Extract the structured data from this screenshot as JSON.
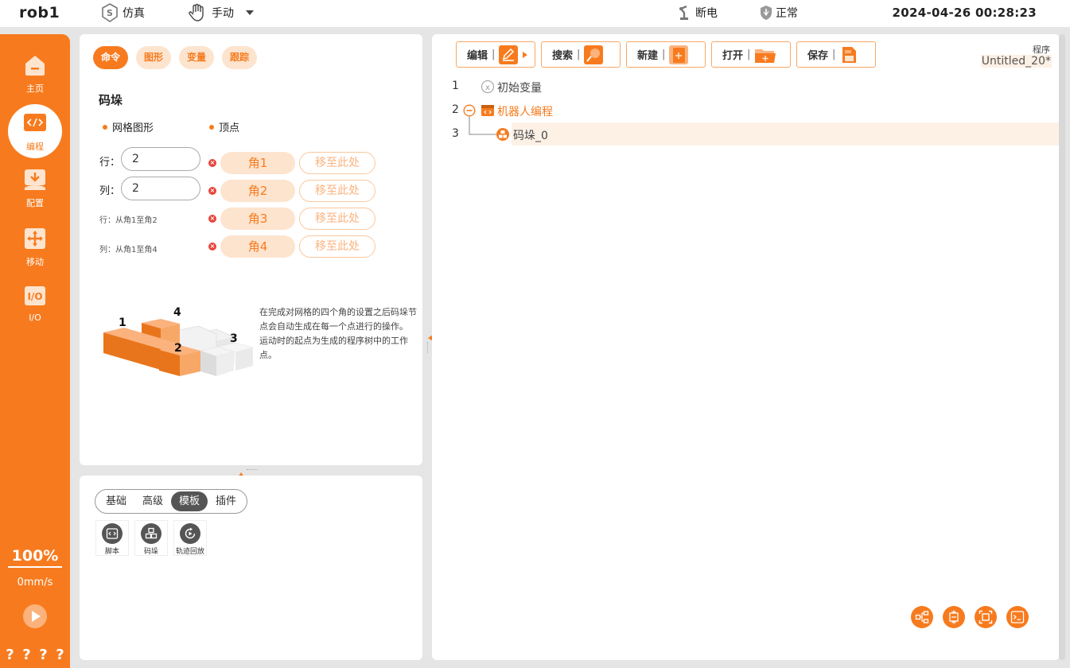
{
  "topbar": {
    "robot_name": "rob1",
    "sim_label": "仿真",
    "mode_label": "手动",
    "power_label": "断电",
    "status_label": "正常",
    "datetime": "2024-04-26 00:28:23"
  },
  "nav": {
    "items": [
      {
        "label": "主页",
        "icon": "home-icon"
      },
      {
        "label": "编程",
        "icon": "code-icon",
        "active": true
      },
      {
        "label": "配置",
        "icon": "config-download-icon"
      },
      {
        "label": "移动",
        "icon": "move-arrows-icon"
      },
      {
        "label": "I/O",
        "icon": "io-icon"
      }
    ],
    "speed_percent": "100%",
    "speed_value": "0mm/s",
    "help": [
      "?",
      "?",
      "?",
      "?"
    ]
  },
  "command_panel": {
    "tabs": [
      "命令",
      "图形",
      "变量",
      "跟踪"
    ],
    "active_tab": "命令",
    "section_title": "码垛",
    "mode_options": [
      "网格图形",
      "顶点"
    ],
    "row_label": "行：",
    "row_value": "2",
    "col_label": "列：",
    "col_value": "2",
    "row_hint": "行：从角1至角2",
    "col_hint": "列：从角1至角4",
    "corners": [
      "角1",
      "角2",
      "角3",
      "角4"
    ],
    "move_here": "移至此处",
    "illustration_labels": [
      "1",
      "2",
      "3",
      "4"
    ],
    "description_1": "在完成对网格的四个角的设置之后码垛节点会自动生成在每一个点进行的操作。",
    "description_2": "运动时的起点为生成的程序树中的工作点。"
  },
  "library_panel": {
    "tabs": [
      "基础",
      "高级",
      "模板",
      "插件"
    ],
    "active_tab": "模板",
    "items": [
      {
        "label": "脚本",
        "icon": "script-icon"
      },
      {
        "label": "码垛",
        "icon": "palletize-icon"
      },
      {
        "label": "轨迹回放",
        "icon": "trajectory-replay-icon"
      }
    ]
  },
  "program_panel": {
    "toolbar": {
      "edit": "编辑",
      "search": "搜索",
      "new": "新建",
      "open": "打开",
      "save": "保存"
    },
    "program_label": "程序",
    "program_name": "Untitled_20*",
    "tree": [
      {
        "line": "1",
        "label": "初始变量",
        "icon": "init-variables-icon"
      },
      {
        "line": "2",
        "label": "机器人编程",
        "icon": "robot-program-icon"
      },
      {
        "line": "3",
        "label": "码垛_0",
        "icon": "palletize-node-icon",
        "selected": true
      }
    ],
    "bottom_tools": [
      "expand-tree-icon",
      "collapse-tree-icon",
      "fit-view-icon",
      "terminal-icon"
    ]
  },
  "colors": {
    "accent": "#f77b1e",
    "accent_light": "#fde4cf",
    "danger": "#e8443a",
    "selected_row": "#fdf1e6"
  }
}
